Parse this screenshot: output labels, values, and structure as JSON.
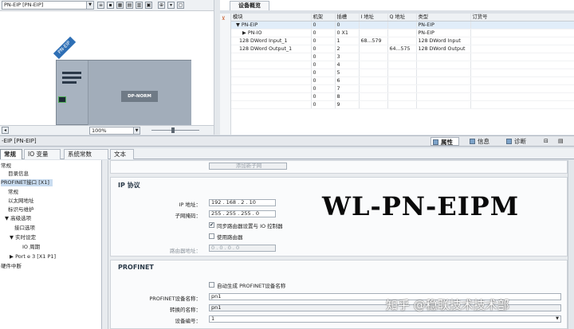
{
  "topology": {
    "device_select": "PN-EIP [PN-EIP]",
    "device_tag": "PN-EIP",
    "module_label": "DP-NORM",
    "zoom": "100%"
  },
  "overview": {
    "tab_label": "设备概览",
    "columns": [
      "模块",
      "机架",
      "插槽",
      "I 地址",
      "Q 地址",
      "类型",
      "订货号"
    ],
    "rows": [
      [
        "▼ PN-EIP",
        "0",
        "0",
        "",
        "",
        "PN-EIP",
        ""
      ],
      [
        "▶ PN-IO",
        "0",
        "0 X1",
        "",
        "",
        "PN-EIP",
        ""
      ],
      [
        "128 DWord Input_1",
        "0",
        "1",
        "68...579",
        "",
        "128 DWord Input",
        ""
      ],
      [
        "128 DWord Output_1",
        "0",
        "2",
        "",
        "64...575",
        "128 DWord Output",
        ""
      ],
      [
        "",
        "0",
        "3",
        "",
        "",
        "",
        ""
      ],
      [
        "",
        "0",
        "4",
        "",
        "",
        "",
        ""
      ],
      [
        "",
        "0",
        "5",
        "",
        "",
        "",
        ""
      ],
      [
        "",
        "0",
        "6",
        "",
        "",
        "",
        ""
      ],
      [
        "",
        "0",
        "7",
        "",
        "",
        "",
        ""
      ],
      [
        "",
        "0",
        "8",
        "",
        "",
        "",
        ""
      ],
      [
        "",
        "0",
        "9",
        "",
        "",
        "",
        ""
      ]
    ]
  },
  "properties": {
    "title": "-EIP [PN-EIP]",
    "tabs": [
      "属性",
      "信息",
      "诊断"
    ],
    "subtabs": [
      "常规",
      "IO 变量",
      "系统常数",
      "文本"
    ],
    "nav": [
      "常规",
      "目录信息",
      "PROFINET接口 [X1]",
      "常规",
      "以太网地址",
      "标识与维护",
      "▼ 高级选项",
      "接口选项",
      "▼ 实时设定",
      "IO 周期",
      "▶ Port e 3 [X1 P1]",
      "硬件中断"
    ],
    "add_subnet": "添加新子网",
    "ip_section": "IP 协议",
    "ip_label": "IP 地址：",
    "ip": [
      "192",
      "168",
      "2",
      "10"
    ],
    "mask_label": "子网掩码：",
    "mask": [
      "255",
      "255",
      "255",
      "0"
    ],
    "sync_router": "同步路由器设置与 IO 控制器",
    "use_router": "使用路由器",
    "router_label": "路由器地址：",
    "router": [
      "0",
      "0",
      "0",
      "0"
    ],
    "profinet_section": "PROFINET",
    "auto_name": "自动生成 PROFINET设备名称",
    "pn_name_label": "PROFINET设备名称：",
    "pn_name": "pn1",
    "conv_name_label": "转换的名称：",
    "conv_name": "pn1",
    "dev_num_label": "设备编号：",
    "dev_num": "1"
  },
  "overlay_text": "WL-PN-EIPM",
  "watermark": "知乎 @稳联技术技术部"
}
